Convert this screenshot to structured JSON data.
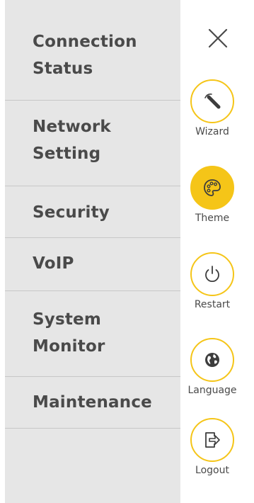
{
  "menu": {
    "items": [
      {
        "label": "Connection\nStatus"
      },
      {
        "label": "Network\nSetting"
      },
      {
        "label": "Security"
      },
      {
        "label": "VoIP"
      },
      {
        "label": "System\nMonitor"
      },
      {
        "label": "Maintenance"
      }
    ]
  },
  "tools": {
    "wizard": {
      "label": "Wizard",
      "icon": "wizard-wand-icon"
    },
    "theme": {
      "label": "Theme",
      "icon": "palette-icon"
    },
    "restart": {
      "label": "Restart",
      "icon": "power-icon"
    },
    "language": {
      "label": "Language",
      "icon": "globe-icon"
    },
    "logout": {
      "label": "Logout",
      "icon": "logout-icon"
    }
  },
  "colors": {
    "accent": "#f5c518",
    "menu_bg": "#e6e6e6",
    "text": "#4a4a4a"
  }
}
